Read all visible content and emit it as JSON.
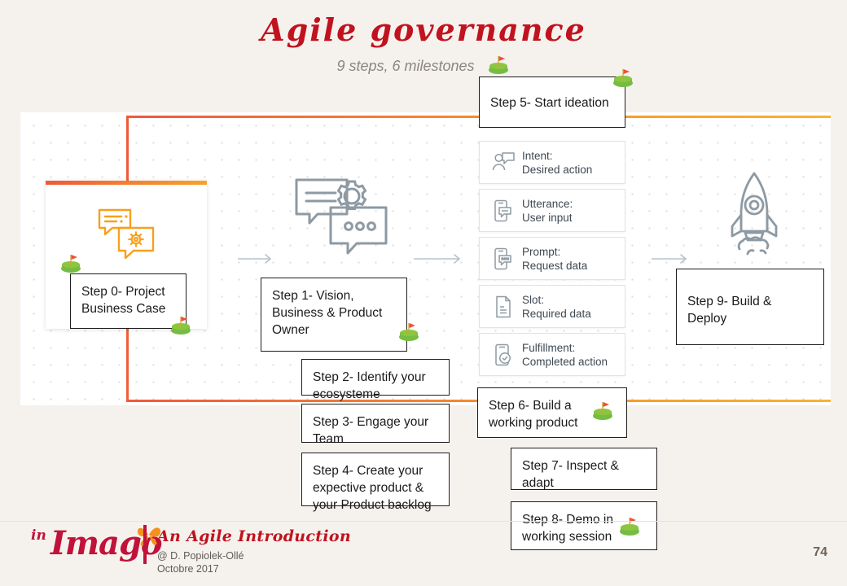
{
  "slide": {
    "title": "Agile governance",
    "subtitle": "9 steps, 6 milestones",
    "page_number": "74",
    "accent_colors": {
      "title_red": "#c1121f",
      "orange_start": "#ee5a3a",
      "orange_end": "#f9b233",
      "icon_gray": "#8e9aa3",
      "background": "#f5f2ed"
    }
  },
  "left_card": {
    "icon": "chat-gear-icon"
  },
  "center_graphic": {
    "icon": "chat-bubbles-gear-icon"
  },
  "right_graphic": {
    "icon": "rocket-icon"
  },
  "steps": [
    {
      "id": "step-0",
      "label": "Step 0- Project Business Case"
    },
    {
      "id": "step-1",
      "label": "Step 1- Vision, Business & Product Owner"
    },
    {
      "id": "step-2",
      "label": "Step 2- Identify your ecosysteme"
    },
    {
      "id": "step-3",
      "label": "Step 3- Engage your Team"
    },
    {
      "id": "step-4",
      "label": "Step 4- Create your expective product & your Product backlog"
    },
    {
      "id": "step-5",
      "label": "Step 5- Start ideation"
    },
    {
      "id": "step-6",
      "label": "Step 6- Build a working product"
    },
    {
      "id": "step-7",
      "label": "Step 7- Inspect & adapt"
    },
    {
      "id": "step-8",
      "label": "Step 8- Demo in working session"
    },
    {
      "id": "step-9",
      "label": "Step 9-  Build & Deploy"
    }
  ],
  "info_cards": [
    {
      "icon": "person-speech-icon",
      "line1": "Intent:",
      "line2": "Desired action"
    },
    {
      "icon": "phone-message-icon",
      "line1": "Utterance:",
      "line2": "User input"
    },
    {
      "icon": "phone-prompt-icon",
      "line1": "Prompt:",
      "line2": "Request data"
    },
    {
      "icon": "document-icon",
      "line1": "Slot:",
      "line2": "Required data"
    },
    {
      "icon": "phone-check-icon",
      "line1": "Fulfillment:",
      "line2": "Completed action"
    }
  ],
  "milestones": [
    {
      "id": "milestone-subtitle",
      "name": "golf-flag-icon"
    },
    {
      "id": "milestone-step0-start",
      "name": "golf-flag-icon"
    },
    {
      "id": "milestone-step0-end",
      "name": "golf-flag-icon"
    },
    {
      "id": "milestone-step1",
      "name": "golf-flag-icon"
    },
    {
      "id": "milestone-step5",
      "name": "golf-flag-icon"
    },
    {
      "id": "milestone-step6",
      "name": "golf-flag-icon"
    },
    {
      "id": "milestone-step8",
      "name": "golf-flag-icon"
    }
  ],
  "footer": {
    "logo_in": "in",
    "logo_name": "Imago",
    "title": "An Agile Introduction",
    "author": "@ D. Popiolek-Ollé",
    "date": "Octobre 2017"
  }
}
